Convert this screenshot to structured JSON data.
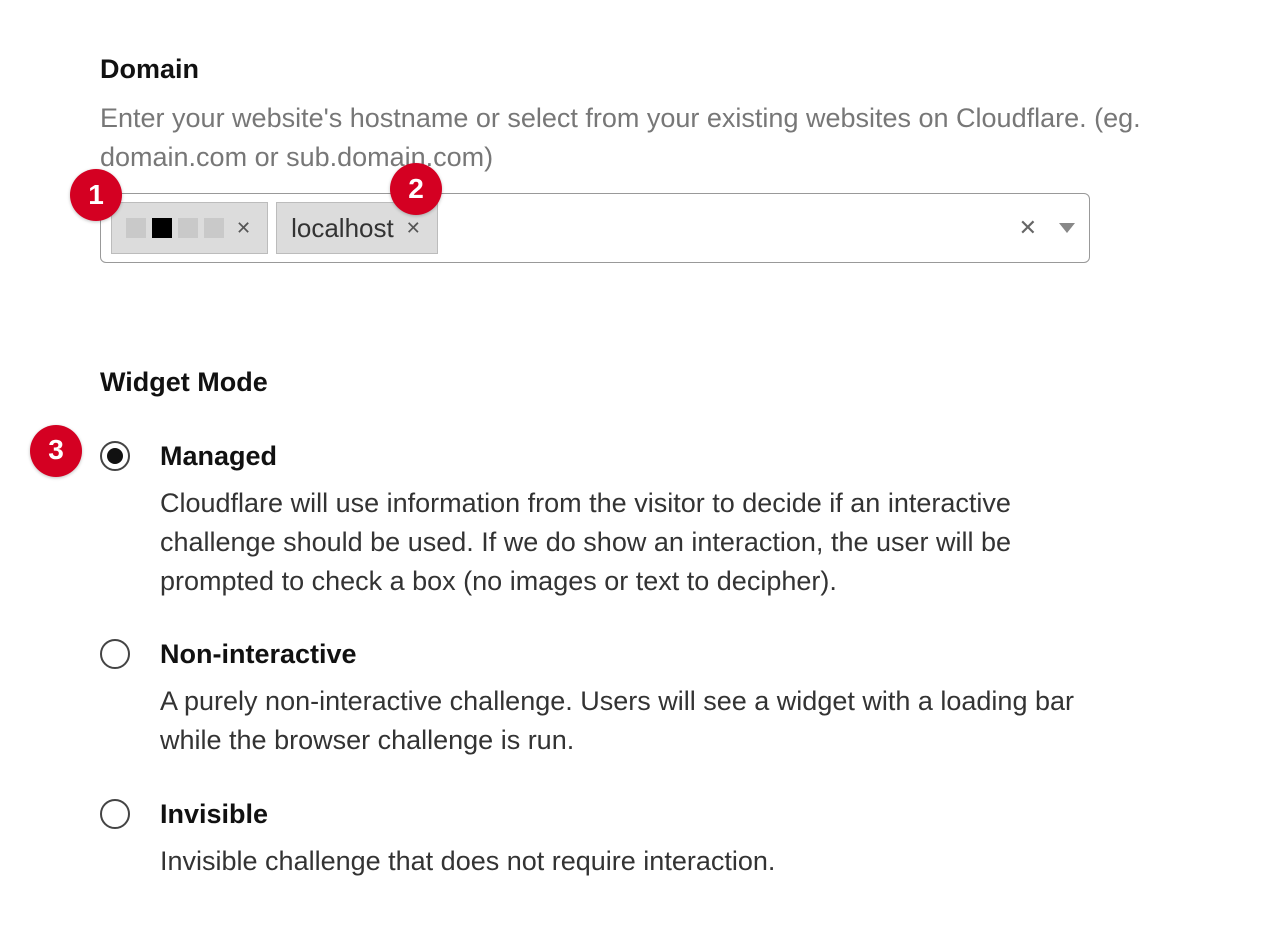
{
  "domain": {
    "title": "Domain",
    "description": "Enter your website's hostname or select from your existing websites on Cloudflare. (eg. domain.com or sub.domain.com)",
    "tags": [
      {
        "id": "redacted",
        "label": ""
      },
      {
        "id": "localhost",
        "label": "localhost"
      }
    ]
  },
  "widget_mode": {
    "title": "Widget Mode",
    "options": [
      {
        "id": "managed",
        "label": "Managed",
        "description": "Cloudflare will use information from the visitor to decide if an interactive challenge should be used. If we do show an interaction, the user will be prompted to check a box (no images or text to decipher).",
        "selected": true
      },
      {
        "id": "non-interactive",
        "label": "Non-interactive",
        "description": "A purely non-interactive challenge. Users will see a widget with a loading bar while the browser challenge is run.",
        "selected": false
      },
      {
        "id": "invisible",
        "label": "Invisible",
        "description": "Invisible challenge that does not require interaction.",
        "selected": false
      }
    ]
  },
  "markers": {
    "one": "1",
    "two": "2",
    "three": "3"
  },
  "colors": {
    "marker": "#d40022"
  }
}
